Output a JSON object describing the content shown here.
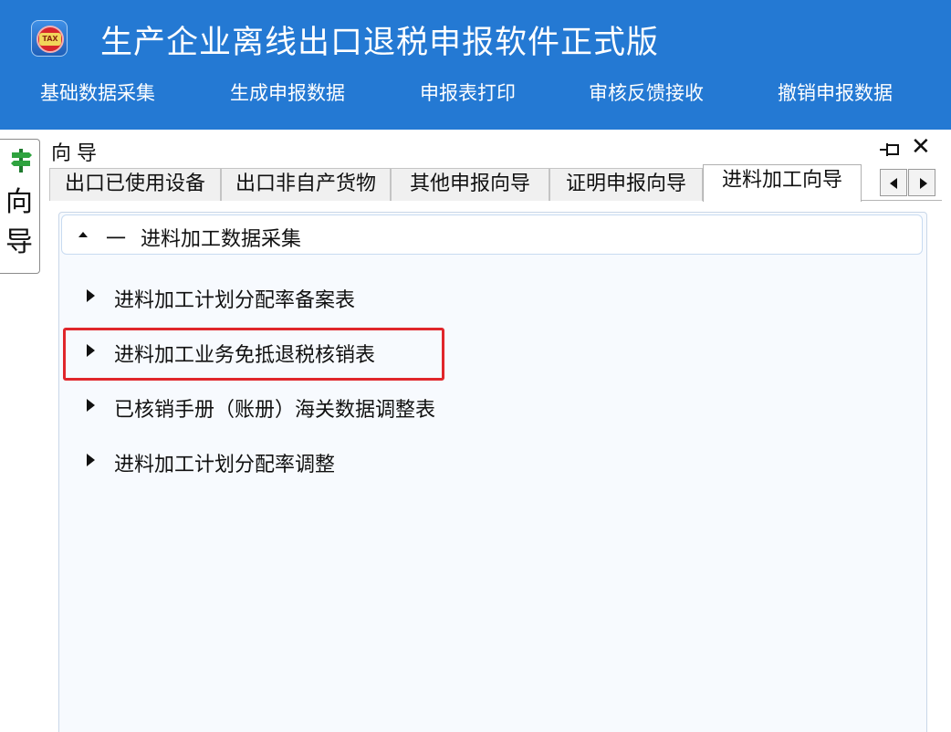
{
  "app": {
    "title": "生产企业离线出口退税申报软件正式版",
    "logo_icon": "tax-logo-icon",
    "header_color": "#2479d3"
  },
  "menu": [
    {
      "label": "基础数据采集"
    },
    {
      "label": "生成申报数据"
    },
    {
      "label": "申报表打印"
    },
    {
      "label": "审核反馈接收"
    },
    {
      "label": "撤销申报数据"
    }
  ],
  "side_dock": {
    "icon": "signpost-icon",
    "label_chars": [
      "向",
      "导"
    ]
  },
  "panel": {
    "title": "向导",
    "pin_icon": "pin-icon",
    "close_glyph": "✕",
    "tabs": [
      {
        "label": "出口已使用设备",
        "active": false
      },
      {
        "label": "出口非自产货物",
        "active": false
      },
      {
        "label": "其他申报向导",
        "active": false
      },
      {
        "label": "证明申报向导",
        "active": false
      },
      {
        "label": "进料加工向导",
        "active": true
      }
    ]
  },
  "group": {
    "dash": "一",
    "title": "进料加工数据采集",
    "items": [
      {
        "label": "进料加工计划分配率备案表",
        "highlighted": false
      },
      {
        "label": "进料加工业务免抵退税核销表",
        "highlighted": true
      },
      {
        "label": "已核销手册（账册）海关数据调整表",
        "highlighted": false
      },
      {
        "label": "进料加工计划分配率调整",
        "highlighted": false
      }
    ]
  },
  "colors": {
    "highlight_border": "#e0262b",
    "content_bg": "#f7fafe"
  }
}
